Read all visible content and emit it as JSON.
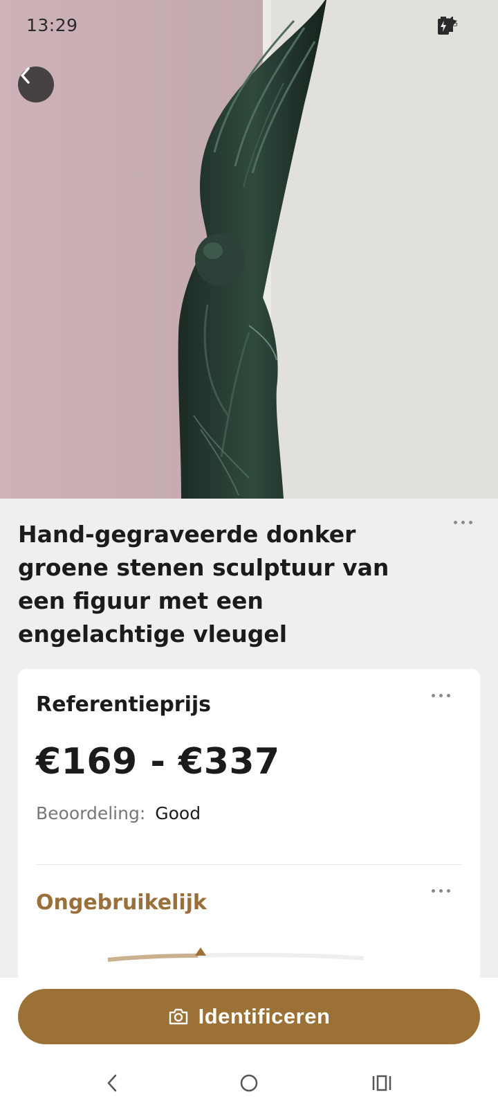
{
  "status_bar": {
    "time": "13:29",
    "network_label": "5G",
    "icons": [
      "call-icon",
      "wifi-icon",
      "signal-icon",
      "battery-charging-icon"
    ]
  },
  "hero": {
    "back_icon": "chevron-left-icon"
  },
  "item": {
    "title": "Hand-gegraveerde donker groene stenen sculptuur van een figuur met een engelachtige vleugel"
  },
  "price_card": {
    "heading": "Referentieprijs",
    "price_range": "€169 - €337",
    "rating_label": "Beoordeling:",
    "rating_value": "Good",
    "rarity_heading": "Ongebruikelijk",
    "rarity_gauge_level": 0.5
  },
  "actions": {
    "identify_label": "Identificeren",
    "identify_icon": "camera-icon"
  },
  "nav": {
    "icons": [
      "nav-back-icon",
      "nav-home-icon",
      "nav-recents-icon"
    ]
  },
  "colors": {
    "accent": "#9c7136",
    "accent_text": "#9a6f3a",
    "text_dark": "#1b1b1b",
    "background": "#efefef"
  }
}
